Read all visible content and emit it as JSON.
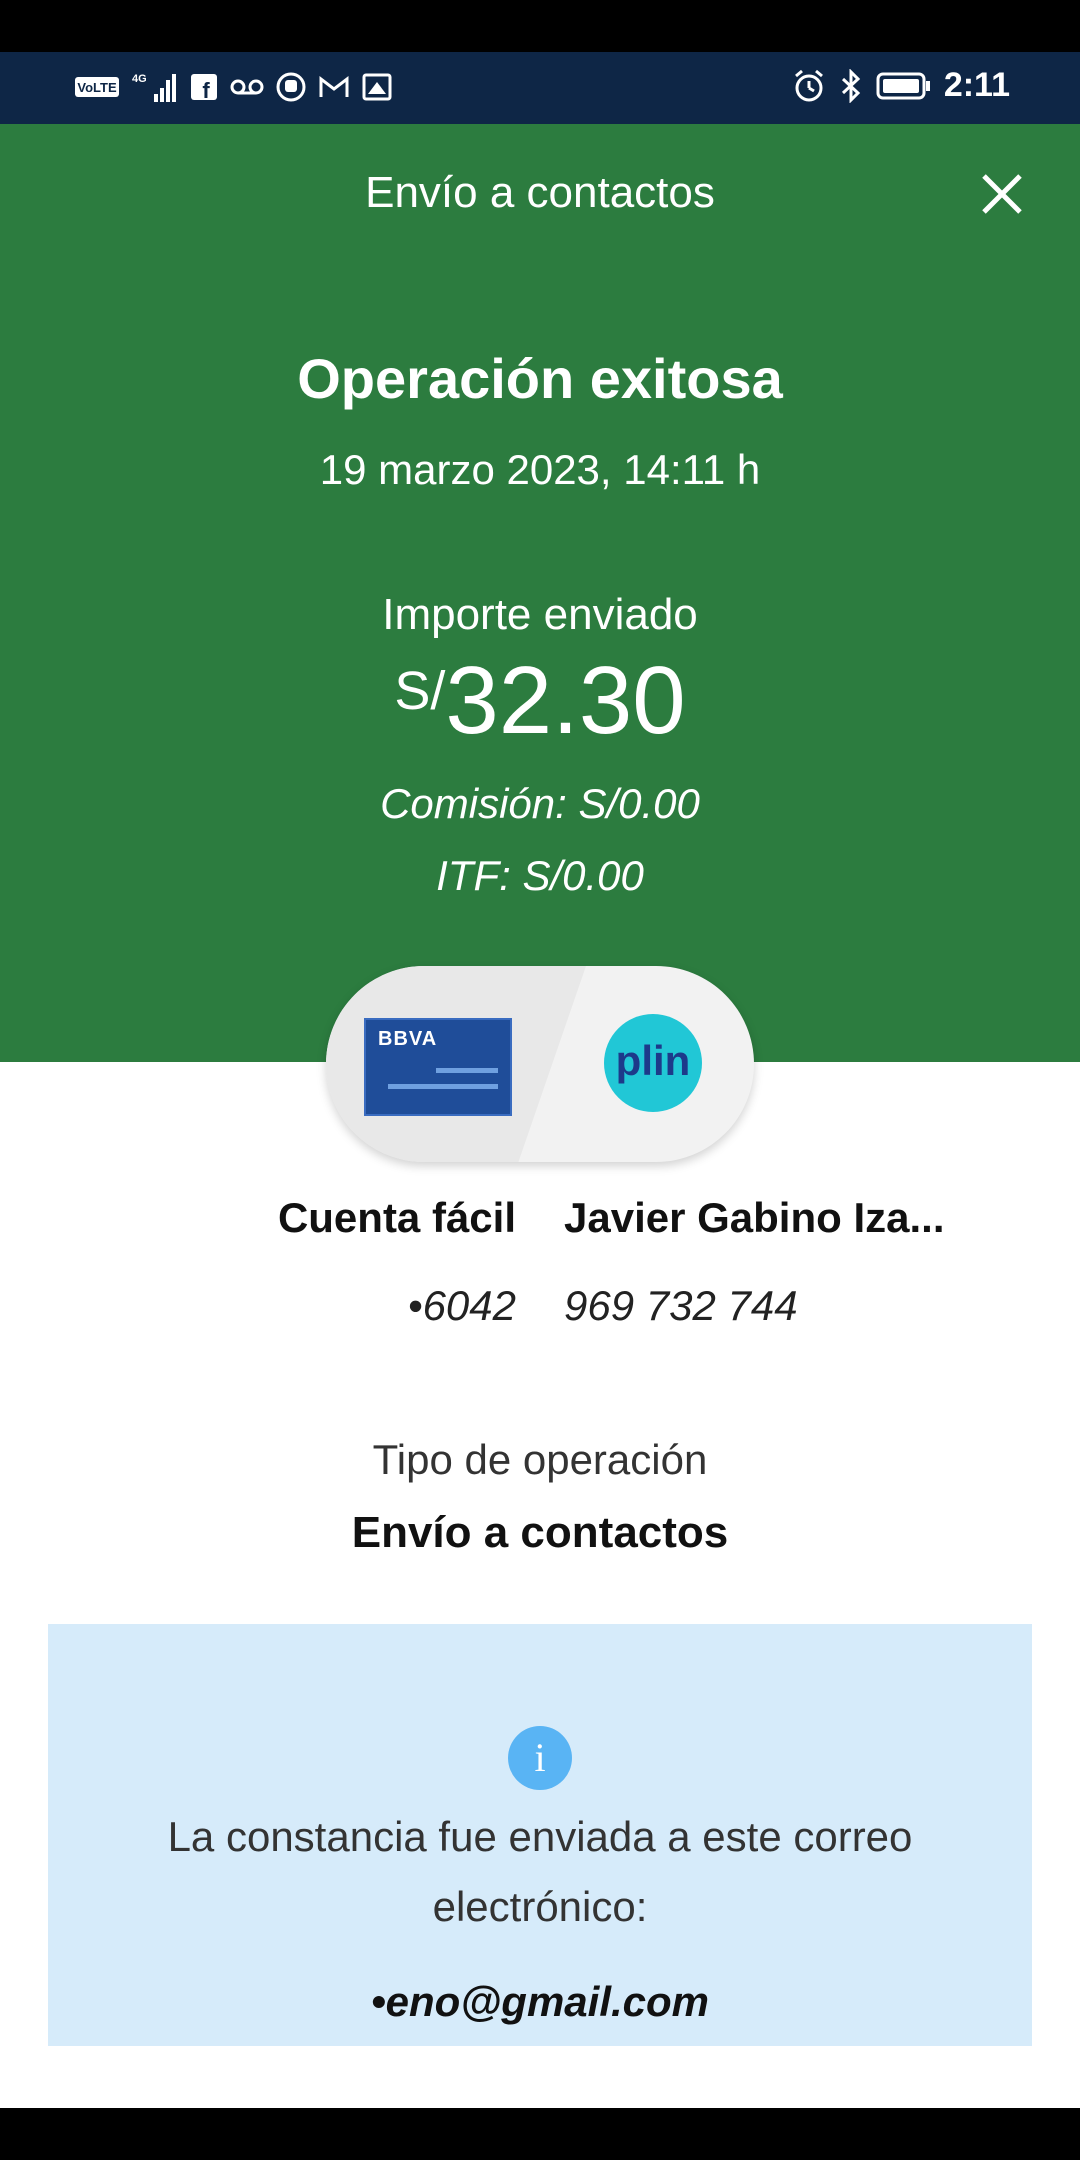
{
  "status_bar": {
    "time": "2:11",
    "left_icons": [
      "volte-icon",
      "signal-4g-icon",
      "facebook-icon",
      "voicemail-icon",
      "hand-icon",
      "gmail-icon",
      "image-icon"
    ],
    "right_icons": [
      "alarm-icon",
      "bluetooth-icon",
      "battery-icon"
    ]
  },
  "header": {
    "title": "Envío a contactos",
    "close_icon": "close-icon"
  },
  "operation": {
    "title": "Operación exitosa",
    "date": "19 marzo 2023, 14:11 h",
    "amount_label": "Importe enviado",
    "currency": "S/",
    "amount": "32.30",
    "commission": "Comisión:  S/0.00",
    "itf": "ITF:  S/0.00"
  },
  "transfer": {
    "from_brand": "BBVA",
    "to_brand": "plin",
    "from_name": "Cuenta fácil",
    "from_number": "•6042",
    "to_name": "Javier Gabino Iza...",
    "to_number": "969 732 744"
  },
  "operation_type": {
    "label": "Tipo de operación",
    "value": "Envío a contactos"
  },
  "info": {
    "icon": "info-icon",
    "message": "La constancia fue enviada a este correo electrónico:",
    "email": "•eno@gmail.com"
  },
  "colors": {
    "green": "#2c7c3f",
    "status_bar": "#0e2646",
    "info_bg": "#d6ebfa",
    "info_icon": "#59b4f4",
    "bbva_blue": "#1f4d99",
    "plin_cyan": "#21c7d6"
  }
}
